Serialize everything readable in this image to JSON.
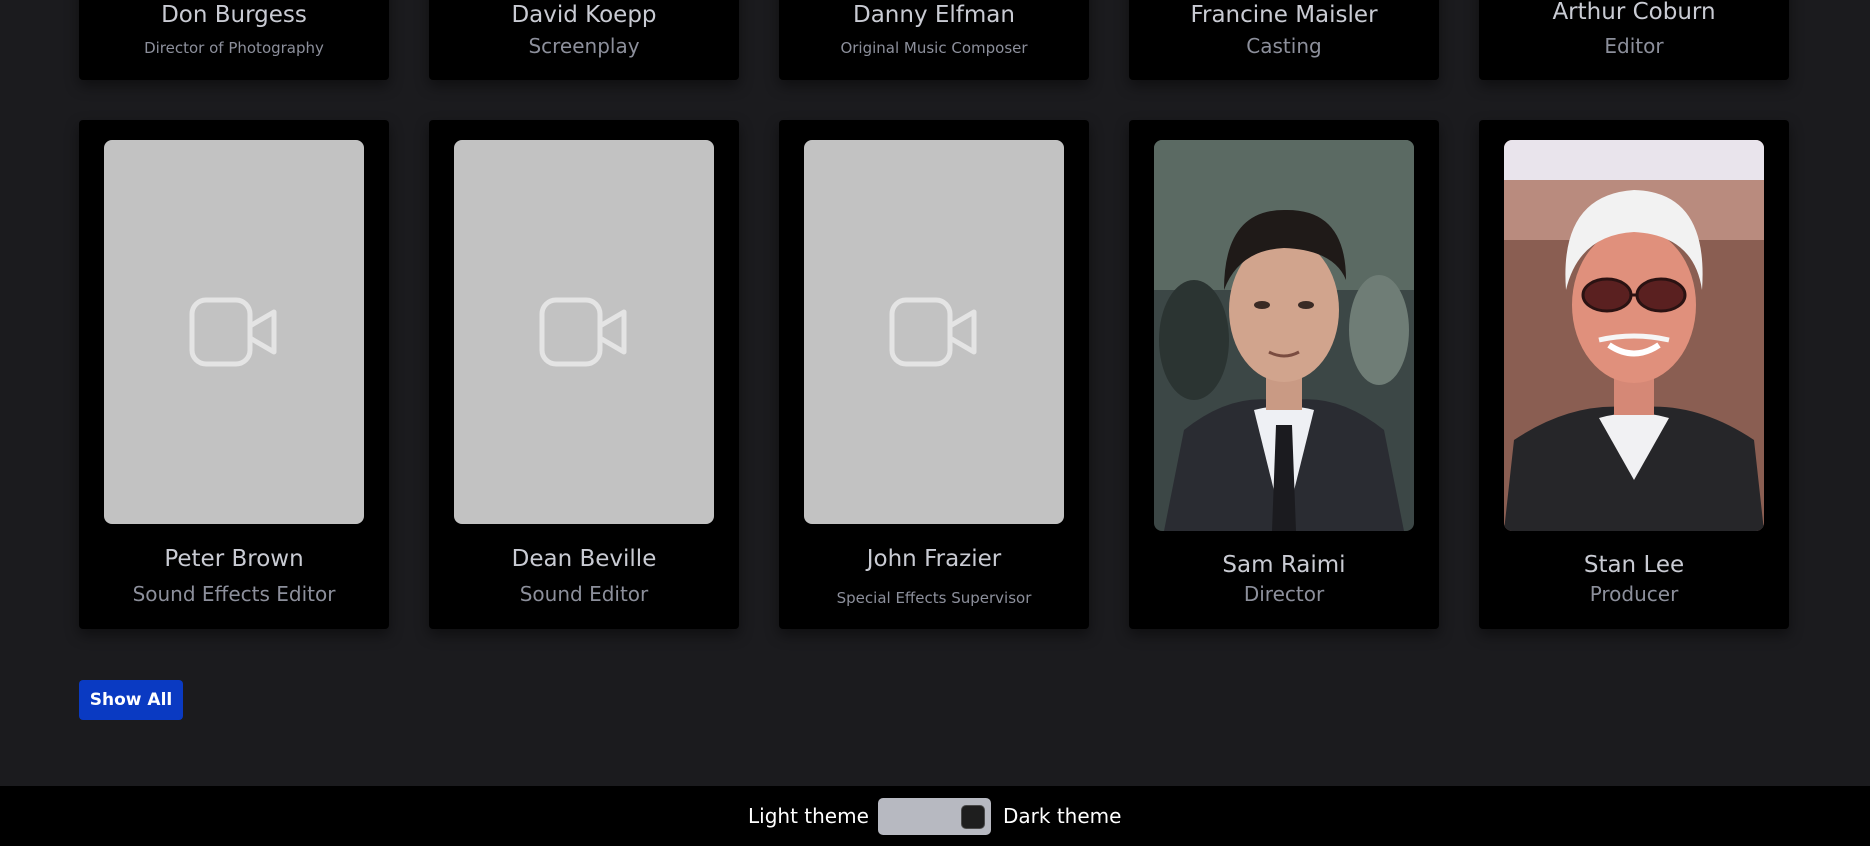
{
  "crew_top": [
    {
      "name": "Don Burgess",
      "role": "Director of Photography"
    },
    {
      "name": "David Koepp",
      "role": "Screenplay"
    },
    {
      "name": "Danny Elfman",
      "role": "Original Music Composer"
    },
    {
      "name": "Francine Maisler",
      "role": "Casting"
    },
    {
      "name": "Arthur Coburn",
      "role": "Editor"
    }
  ],
  "crew": [
    {
      "name": "Peter Brown",
      "role": "Sound Effects Editor",
      "photo": "video-placeholder-icon"
    },
    {
      "name": "Dean Beville",
      "role": "Sound Editor",
      "photo": "video-placeholder-icon"
    },
    {
      "name": "John Frazier",
      "role": "Special Effects Supervisor",
      "photo": "video-placeholder-icon"
    },
    {
      "name": "Sam Raimi",
      "role": "Director",
      "photo": "portrait"
    },
    {
      "name": "Stan Lee",
      "role": "Producer",
      "photo": "portrait"
    }
  ],
  "show_all_label": "Show All",
  "footer": {
    "light_label": "Light theme",
    "dark_label": "Dark theme",
    "theme": "dark"
  },
  "colors": {
    "background": "#1b1b1e",
    "card": "#000000",
    "button": "#0a3ac2",
    "placeholder": "#c2c2c2"
  }
}
